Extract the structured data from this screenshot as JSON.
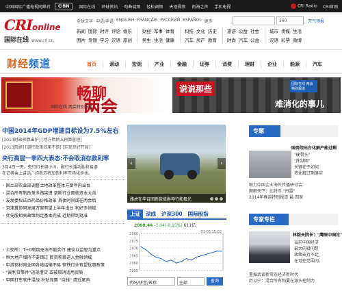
{
  "topbar": {
    "network": "中国国际广播电视网络台",
    "cibn": "CIBN",
    "channels": [
      "国际在线",
      "环球资讯",
      "劲曲调频",
      "轻松调频",
      "天地视频",
      "南海之声",
      "手机电视"
    ],
    "right": [
      "CRI Radio",
      "CRI官网"
    ]
  },
  "header": {
    "logo_main": "CRI",
    "logo_online": "online",
    "logo_sub": "国际在线",
    "logo_url": "www.cri.cn",
    "languages": [
      "全球文字",
      "中语/手语",
      "ENGLISH",
      "FRANÇAIS",
      "РУССКИЙ",
      "ESPAÑOL",
      "更多"
    ],
    "search_select": "360",
    "weather": "天气预报",
    "nav": [
      {
        "rows": [
          [
            "新闻",
            "国际",
            "时评",
            "评论",
            "娱乐"
          ],
          [
            "图片",
            "专题",
            "学习",
            "汉语",
            "原创"
          ]
        ]
      },
      {
        "rows": [
          [
            "财经",
            "军事",
            "体育"
          ],
          [
            "民生",
            "生活",
            "健康"
          ]
        ]
      },
      {
        "rows": [
          [
            "科技",
            "文化",
            "历史"
          ],
          [
            "汽车",
            "房产",
            "教育"
          ]
        ]
      },
      {
        "rows": [
          [
            "旅游",
            "公益",
            "社会"
          ],
          [
            "时尚",
            "汽车",
            "公益"
          ]
        ]
      },
      {
        "rows": [
          [
            "城市",
            "传媒",
            "生活"
          ],
          [
            "汉语",
            "彩票",
            "微博"
          ]
        ]
      }
    ]
  },
  "channel": {
    "logo_a": "财经",
    "logo_b": "频道",
    "nav": [
      "首页",
      "滚动",
      "宏观",
      "产业",
      "金融",
      "证券",
      "消费",
      "理财",
      "企业",
      "能源",
      "汽车"
    ]
  },
  "banners": {
    "left_big_a": "畅聊",
    "left_big_b": "两会",
    "left_small": "国际在线 两会特别报道",
    "right_tag": "说说那些",
    "right_main": "难消化的事儿",
    "right_badge": "国际在线 两会特别报道"
  },
  "news": {
    "headline": "中国2014年GDP增速目标设为7.5%左右",
    "sub1": "[2014财政预算出炉] [地方债纳入预算管理]",
    "sub2": "[2013回顾] [调控政策效果不错] [实现良好开局]",
    "headline2": "央行高层一季四大表态:不会取消存款利率",
    "desc1": "3月4日一天，央行行长周小川、副行长潘功胜和易纲",
    "desc2": "在记者会上讲话，均表示将加快利率市场化步伐。",
    "list1": [
      "国土部农业部调整土地改革整体方案年内出台",
      "混合所有制改革多路突进 垄断行业面临资本大战",
      "友发委拟试点药品价格改革 具体时间或在两会后",
      "京津冀协同发展方案有望上半年出台 利好多领域",
      "优先股相关政策制定基本完成 近期得到批准"
    ],
    "list2": [
      "上交所：T+0制度无法不能实行 建议以监管为重点",
      "恒大地产增持不要错过 民资积极进入金融领域",
      "中游钢材向全国各地运输不易 钢铁行业有望优惠政策",
      "\"高利贷事件\"违规借贷 或被取消适用资质",
      "中国打车软件混战 补贴竞赛 \"烧钱\" 或近尾声"
    ]
  },
  "photo": {
    "caption": "路虎在华召回新款揽胜神行和极光",
    "prev": "‹",
    "next": "›"
  },
  "stock": {
    "tabs": [
      "上证",
      "深成",
      "沪深300",
      "国际股指"
    ],
    "value": "2068.44",
    "change": "-3.04(-0.15%)",
    "amount": "611亿",
    "date_label": "03-05 15:02",
    "search_placeholder": "代码/拼音/名称",
    "search_select": "全部",
    "search_button": "查询"
  },
  "chart_data": {
    "type": "line",
    "title": "",
    "xlabel": "",
    "ylabel": "",
    "yticks": [
      "2080",
      "2075",
      "2070",
      "2065",
      "2060",
      "2055"
    ],
    "ylim": [
      2055,
      2080
    ],
    "series": [
      {
        "values": [
          2071,
          2069,
          2066,
          2064,
          2063,
          2061,
          2062,
          2060,
          2061,
          2063,
          2062,
          2064,
          2065,
          2066,
          2067,
          2068,
          2068
        ]
      }
    ]
  },
  "right": {
    "topic_head": "专题",
    "topic_title": "国务院出台化解产能过剩",
    "topic_l1": "\"硬骨头\"",
    "topic_l2": "\"炼狱期\"",
    "topic_l3": "关键在于如何",
    "topic_l4": "将化解过剩落实",
    "topic_link1": "助力中国企业海外传播研讨会",
    "topic_link2": "图解天下：比特币 \"扫雷\"",
    "topic_link3": "2014年春运特别报道 最 回家",
    "expert_head": "专家专栏",
    "expert_title": "林毅夫院长：\"鹰眼中国论\"",
    "expert_l1": "当前中国经济",
    "expert_l2": "最大的疑问是",
    "expert_l3": "政策支持不足",
    "expert_l4": "在可控范围内。",
    "expert_link1": "董振武谈新常态经济新时代",
    "expert_link2": "历以宁：混合所有制要在源头控制力"
  }
}
